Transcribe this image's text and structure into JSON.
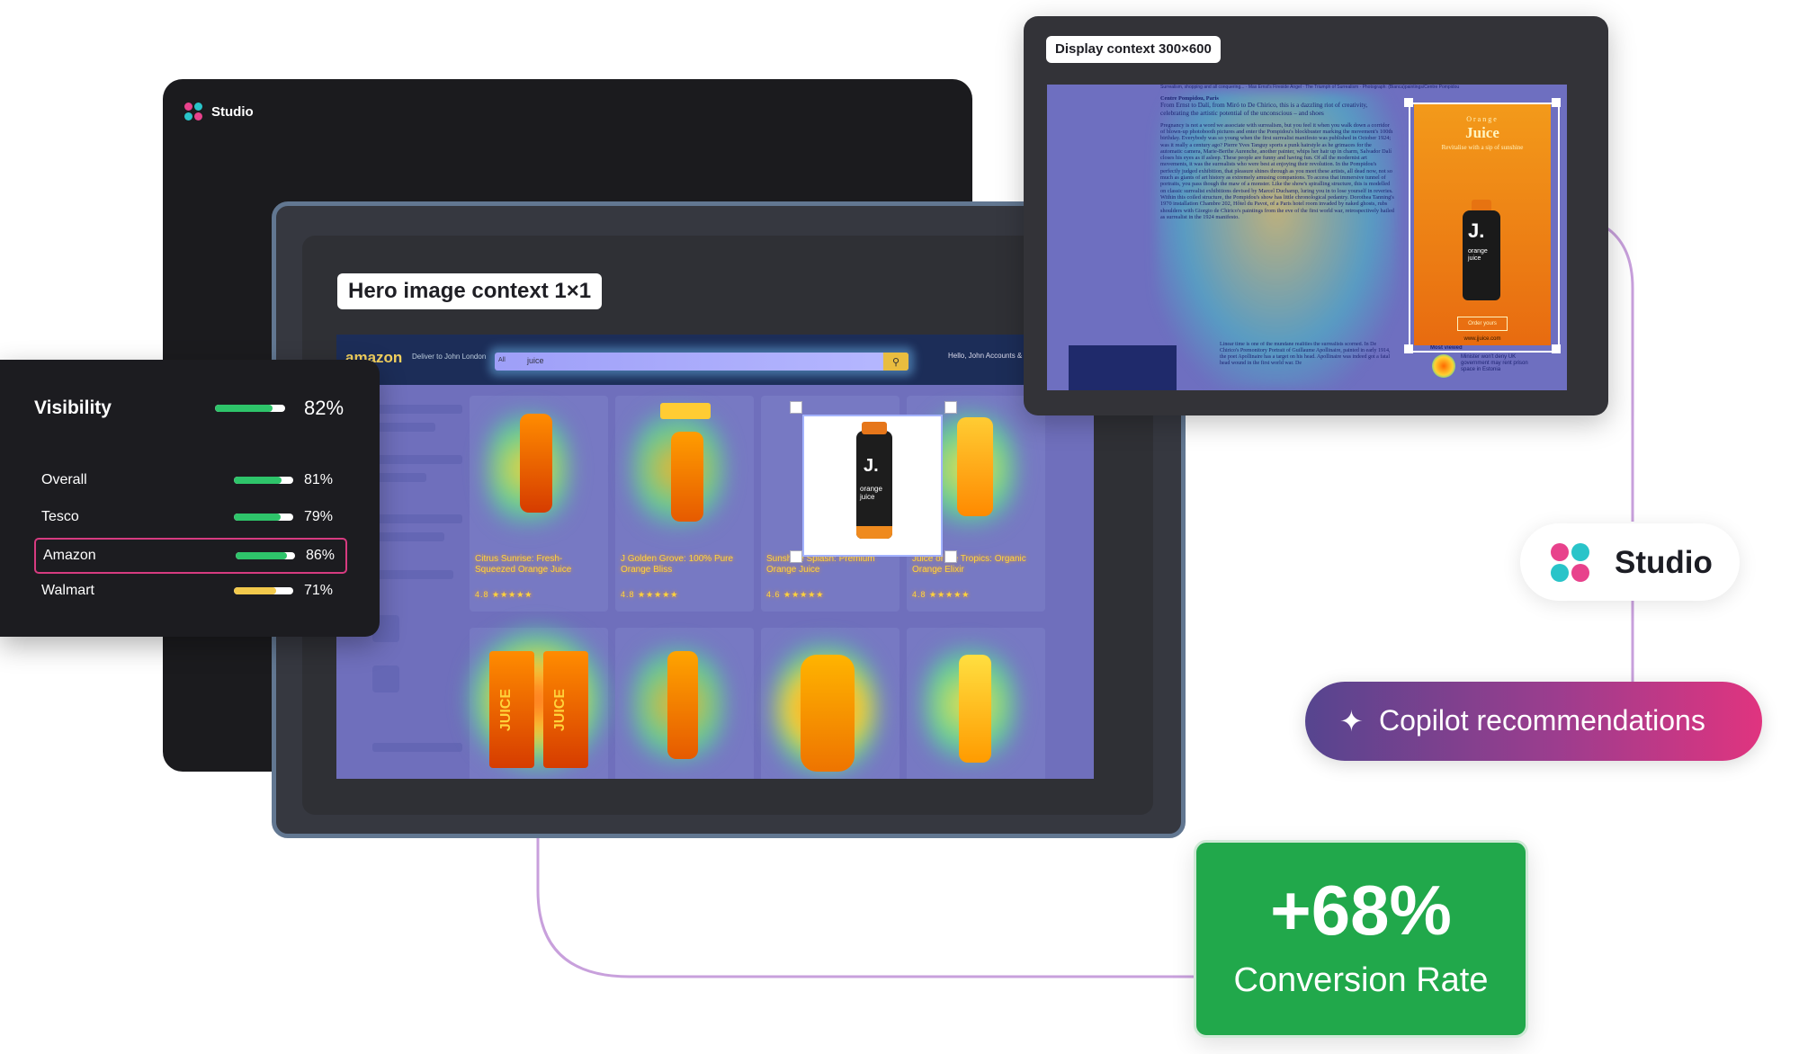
{
  "back_window": {
    "app_name": "Studio"
  },
  "hero": {
    "label": "Hero image context 1×1",
    "amazon": {
      "logo": "amazon",
      "deliver": "Deliver to John London",
      "search_category": "All",
      "search_text": "juice",
      "account": "Hello, John Accounts & Lists",
      "products": [
        {
          "title": "Citrus Sunrise: Fresh-Squeezed Orange Juice",
          "rating": "4.8 ★★★★★"
        },
        {
          "title": "J Golden Grove: 100% Pure Orange Bliss",
          "rating": "4.8 ★★★★★"
        },
        {
          "title": "Sunshine Splash: Premium Orange Juice",
          "rating": "4.6 ★★★★★"
        },
        {
          "title": "Juice of the Tropics: Organic Orange Elixir",
          "rating": "4.8 ★★★★★"
        }
      ],
      "selected_product": {
        "brand": "J.",
        "name": "orange juice"
      },
      "carton_labels": [
        "JUICE",
        "JUICE"
      ]
    }
  },
  "display": {
    "label": "Display context 300×600",
    "article": {
      "breadcrumb": "Surrealism, shopping and all conquering... · Max Ernst's Fireside Angel · The Triumph of Surrealism · Photograph: (Bianca)paintings/Centre Pompidou",
      "kicker": "Centre Pompidou, Paris",
      "headline": "From Ernst to Dalí, from Miró to De Chirico, this is a dazzling riot of creativity, celebrating the artistic potential of the unconscious – and shoes",
      "body": "Pregnancy is not a word we associate with surrealism, but you feel it when you walk down a corridor of blown-up photobooth pictures and enter the Pompidou's blockbuster marking the movement's 100th birthday. Everybody was so young when the first surrealist manifesto was published in October 1924; was it really a century ago? Pierre Yves Tanguy sports a punk hairstyle as he grimaces for the automatic camera, Marie-Berthe Aurenche, another painter, whips her hair up in charm, Salvador Dalí closes his eyes as if asleep. These people are funny and having fun. Of all the modernist art movements, it was the surrealists who were best at enjoying their revolution. In the Pompidou's perfectly judged exhibition, that pleasure shines through as you meet these artists, all dead now, not so much as giants of art history as extremely amusing companions. To access that immersive tunnel of portraits, you pass though the maw of a monster. Like the show's spiralling structure, this is modelled on classic surrealist exhibitions devised by Marcel Duchamp, luring you in to lose yourself in reveries. Within this coiled structure, the Pompidou's show has little chronological pedantry. Dorothea Tanning's 1970 installation Chambre 202, Hôtel du Pavot, of a Paris hotel room invaded by naked ghosts, rubs shoulders with Giorgio de Chirico's paintings from the eve of the first world war, retrospectively hailed as surrealist in the 1924 manifesto.",
      "lower": "Linear time is one of the mundane realities the surrealists scorned. In De Chirico's Premonitory Portrait of Guillaume Apollinaire, painted in early 1914, the poet Apollinaire has a target on his head. Apollinaire was indeed got a fatal head wound in the first world war. De",
      "most_viewed": "Most viewed",
      "most_viewed_item": "Minister won't deny UK government may rent prison space in Estonia"
    },
    "ad": {
      "kicker": "Orange",
      "title": "Juice",
      "tagline": "Revitalise with a sip of sunshine",
      "brand": "J.",
      "product": "orange juice",
      "button": "Order yours",
      "url": "www.jjuice.com"
    }
  },
  "visibility": {
    "title": "Visibility",
    "overall_value": "82%",
    "overall_fraction": 0.82,
    "rows": [
      {
        "label": "Overall",
        "value": "81%",
        "fraction": 0.81,
        "color": "#2ec46a"
      },
      {
        "label": "Tesco",
        "value": "79%",
        "fraction": 0.79,
        "color": "#2ec46a"
      },
      {
        "label": "Amazon",
        "value": "86%",
        "fraction": 0.86,
        "color": "#2ec46a"
      },
      {
        "label": "Walmart",
        "value": "71%",
        "fraction": 0.71,
        "color": "#f2c94c"
      }
    ],
    "highlighted_row": "Amazon"
  },
  "studio_pill": {
    "label": "Studio"
  },
  "copilot": {
    "icon": "sparkle-icon",
    "label": "Copilot recommendations"
  },
  "conversion": {
    "value": "+68%",
    "label": "Conversion Rate"
  },
  "colors": {
    "logo": [
      "#e8428c",
      "#29c4c9",
      "#29c4c9",
      "#e8428c"
    ],
    "accent_green": "#21a84b",
    "copilot_gradient": [
      "#56458f",
      "#e0347f"
    ],
    "connector": "#c8a0dc"
  }
}
